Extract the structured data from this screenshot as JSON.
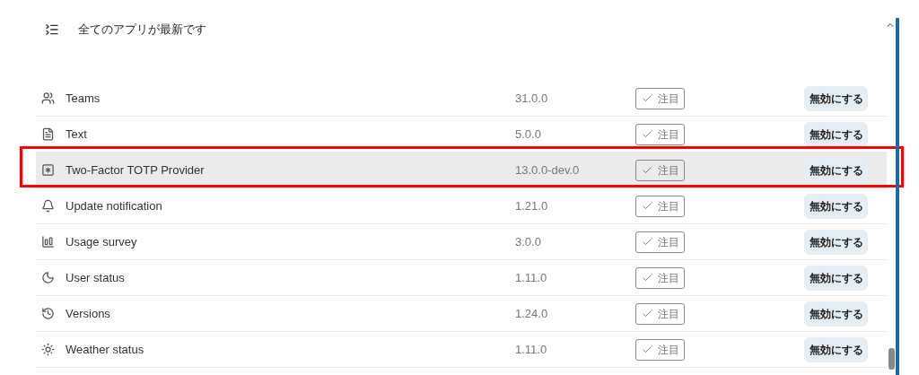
{
  "header": {
    "title": "全てのアプリが最新です"
  },
  "apps": [
    {
      "name": "Teams",
      "version": "31.0.0",
      "badge": "注目",
      "action": "無効にする",
      "selected": false
    },
    {
      "name": "Text",
      "version": "5.0.0",
      "badge": "注目",
      "action": "無効にする",
      "selected": false
    },
    {
      "name": "Two-Factor TOTP Provider",
      "version": "13.0.0-dev.0",
      "badge": "注目",
      "action": "無効にする",
      "selected": true
    },
    {
      "name": "Update notification",
      "version": "1.21.0",
      "badge": "注目",
      "action": "無効にする",
      "selected": false
    },
    {
      "name": "Usage survey",
      "version": "3.0.0",
      "badge": "注目",
      "action": "無効にする",
      "selected": false
    },
    {
      "name": "User status",
      "version": "1.11.0",
      "badge": "注目",
      "action": "無効にする",
      "selected": false
    },
    {
      "name": "Versions",
      "version": "1.24.0",
      "badge": "注目",
      "action": "無効にする",
      "selected": false
    },
    {
      "name": "Weather status",
      "version": "1.11.0",
      "badge": "注目",
      "action": "無効にする",
      "selected": false
    }
  ]
}
